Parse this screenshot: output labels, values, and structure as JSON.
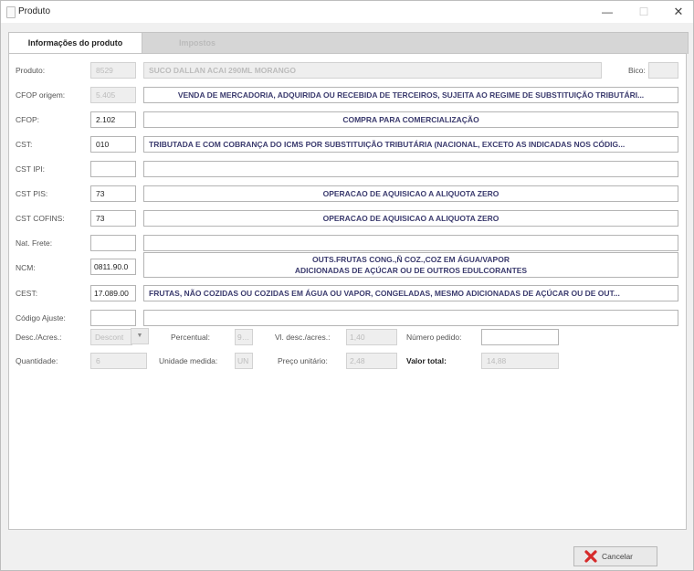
{
  "window": {
    "title": "Produto",
    "minimize": "—",
    "maximize": "☐",
    "close": "✕"
  },
  "tabs": [
    {
      "label": "Informações do produto",
      "active": true
    },
    {
      "label": "Impostos",
      "active": false
    }
  ],
  "fields": {
    "produto": {
      "label": "Produto:",
      "code": "8529",
      "description": "SUCO DALLAN ACAI 290ML MORANGO"
    },
    "bico": {
      "label": "Bico:",
      "value": ""
    },
    "cfop_origem": {
      "label": "CFOP origem:",
      "code": "5.405",
      "description": "VENDA DE MERCADORIA, ADQUIRIDA OU RECEBIDA DE TERCEIROS, SUJEITA AO REGIME DE SUBSTITUIÇÃO TRIBUTÁRI..."
    },
    "cfop": {
      "label": "CFOP:",
      "code": "2.102",
      "description": "COMPRA PARA COMERCIALIZAÇÃO"
    },
    "cst": {
      "label": "CST:",
      "code": "010",
      "description": "TRIBUTADA E COM COBRANÇA DO ICMS POR SUBSTITUIÇÃO TRIBUTÁRIA (NACIONAL, EXCETO AS INDICADAS NOS CÓDIG..."
    },
    "cst_ipi": {
      "label": "CST IPI:",
      "code": "",
      "description": ""
    },
    "cst_pis": {
      "label": "CST PIS:",
      "code": "73",
      "description": "OPERACAO DE AQUISICAO A ALIQUOTA ZERO"
    },
    "cst_cofins": {
      "label": "CST COFINS:",
      "code": "73",
      "description": "OPERACAO DE AQUISICAO A ALIQUOTA ZERO"
    },
    "nat_frete": {
      "label": "Nat. Frete:",
      "code": "",
      "description": ""
    },
    "ncm": {
      "label": "NCM:",
      "code": "0811.90.0",
      "description_line1": "OUTS.FRUTAS CONG.,Ñ COZ.,COZ EM ÁGUA/VAPOR",
      "description_line2": "ADICIONADAS DE AÇÚCAR OU DE OUTROS EDULCORANTES"
    },
    "cest": {
      "label": "CEST:",
      "code": "17.089.00",
      "description": "FRUTAS, NÃO COZIDAS OU COZIDAS EM ÁGUA OU VAPOR, CONGELADAS, MESMO ADICIONADAS DE AÇÚCAR OU DE OUT..."
    },
    "codigo_ajuste": {
      "label": "Código Ajuste:",
      "code": "",
      "description": ""
    }
  },
  "desc_acres": {
    "label": "Desc./Acres.:",
    "value": "Descont",
    "arrow": "▼"
  },
  "percentual": {
    "label": "Percentual:",
    "value": "9,41"
  },
  "vl_desc_acres": {
    "label": "Vl. desc./acres.:",
    "value": "1,40"
  },
  "numero_pedido": {
    "label": "Número pedido:",
    "value": ""
  },
  "quantidade": {
    "label": "Quantidade:",
    "value": "6"
  },
  "unidade_medida": {
    "label": "Unidade medida:",
    "value": "UN"
  },
  "preco_unitario": {
    "label": "Preço unitário:",
    "value": "2,48"
  },
  "valor_total": {
    "label": "Valor total:",
    "value": "14,88"
  },
  "buttons": {
    "cancelar": "Cancelar"
  },
  "colors": {
    "description_text": "#3b3b6e",
    "cancel_icon": "#d62b2b"
  }
}
